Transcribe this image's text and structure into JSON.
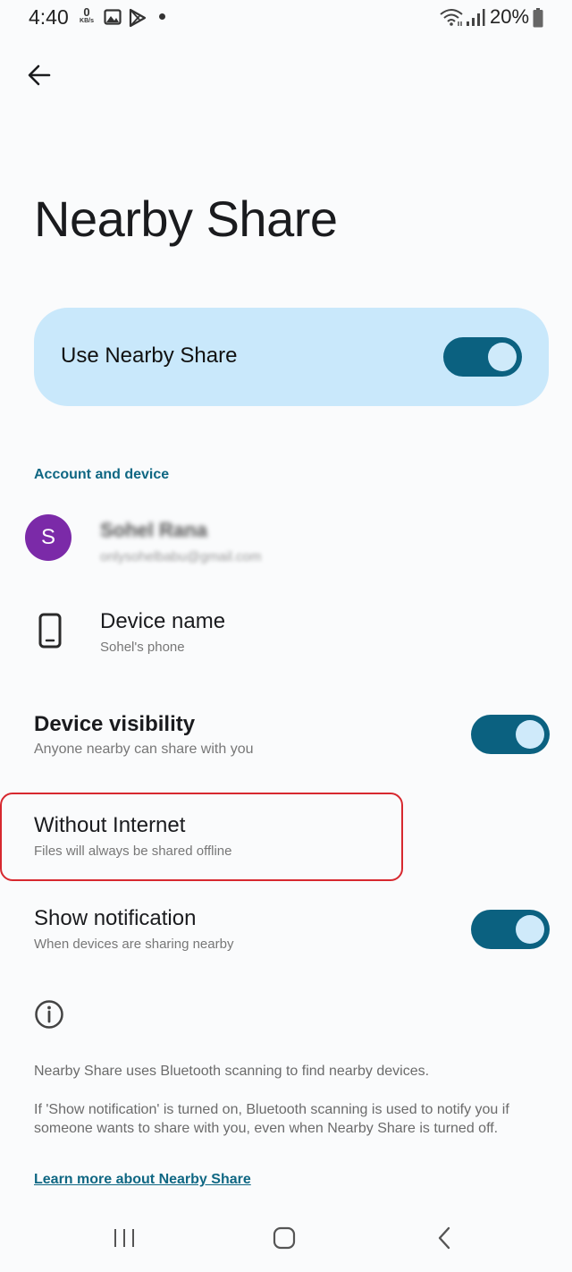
{
  "status_bar": {
    "time": "4:40",
    "net_speed_value": "0",
    "net_speed_unit": "KB/s",
    "battery_text": "20%",
    "icons": [
      "gallery-icon",
      "play-store-icon",
      "notification-dot",
      "wifi-icon",
      "signal-icon",
      "battery-icon"
    ]
  },
  "page": {
    "title": "Nearby Share"
  },
  "main_toggle": {
    "label": "Use Nearby Share",
    "on": true
  },
  "section": {
    "account_and_device": "Account and device"
  },
  "account": {
    "avatar_letter": "S",
    "name": "Sohel Rana",
    "email": "onlysohelbabu@gmail.com",
    "avatar_color": "#7b2aa8"
  },
  "device_name": {
    "title": "Device name",
    "value": "Sohel's phone"
  },
  "device_visibility": {
    "title": "Device visibility",
    "subtitle": "Anyone nearby can share with you",
    "on": true
  },
  "without_internet": {
    "title": "Without Internet",
    "subtitle": "Files will always be shared offline"
  },
  "show_notification": {
    "title": "Show notification",
    "subtitle": "When devices are sharing nearby",
    "on": true
  },
  "info": {
    "paragraph1": "Nearby Share uses Bluetooth scanning to find nearby devices.",
    "paragraph2": "If 'Show notification' is turned on, Bluetooth scanning is used to notify you if someone wants to share with you, even when Nearby Share is turned off.",
    "learn_more": "Learn more about Nearby Share"
  },
  "colors": {
    "accent": "#0b6180",
    "card_bg": "#c9e8fb",
    "highlight": "#d7282f",
    "link": "#0f6783"
  },
  "navbar": {
    "icons": [
      "recent-apps-icon",
      "home-icon",
      "back-nav-icon"
    ]
  }
}
